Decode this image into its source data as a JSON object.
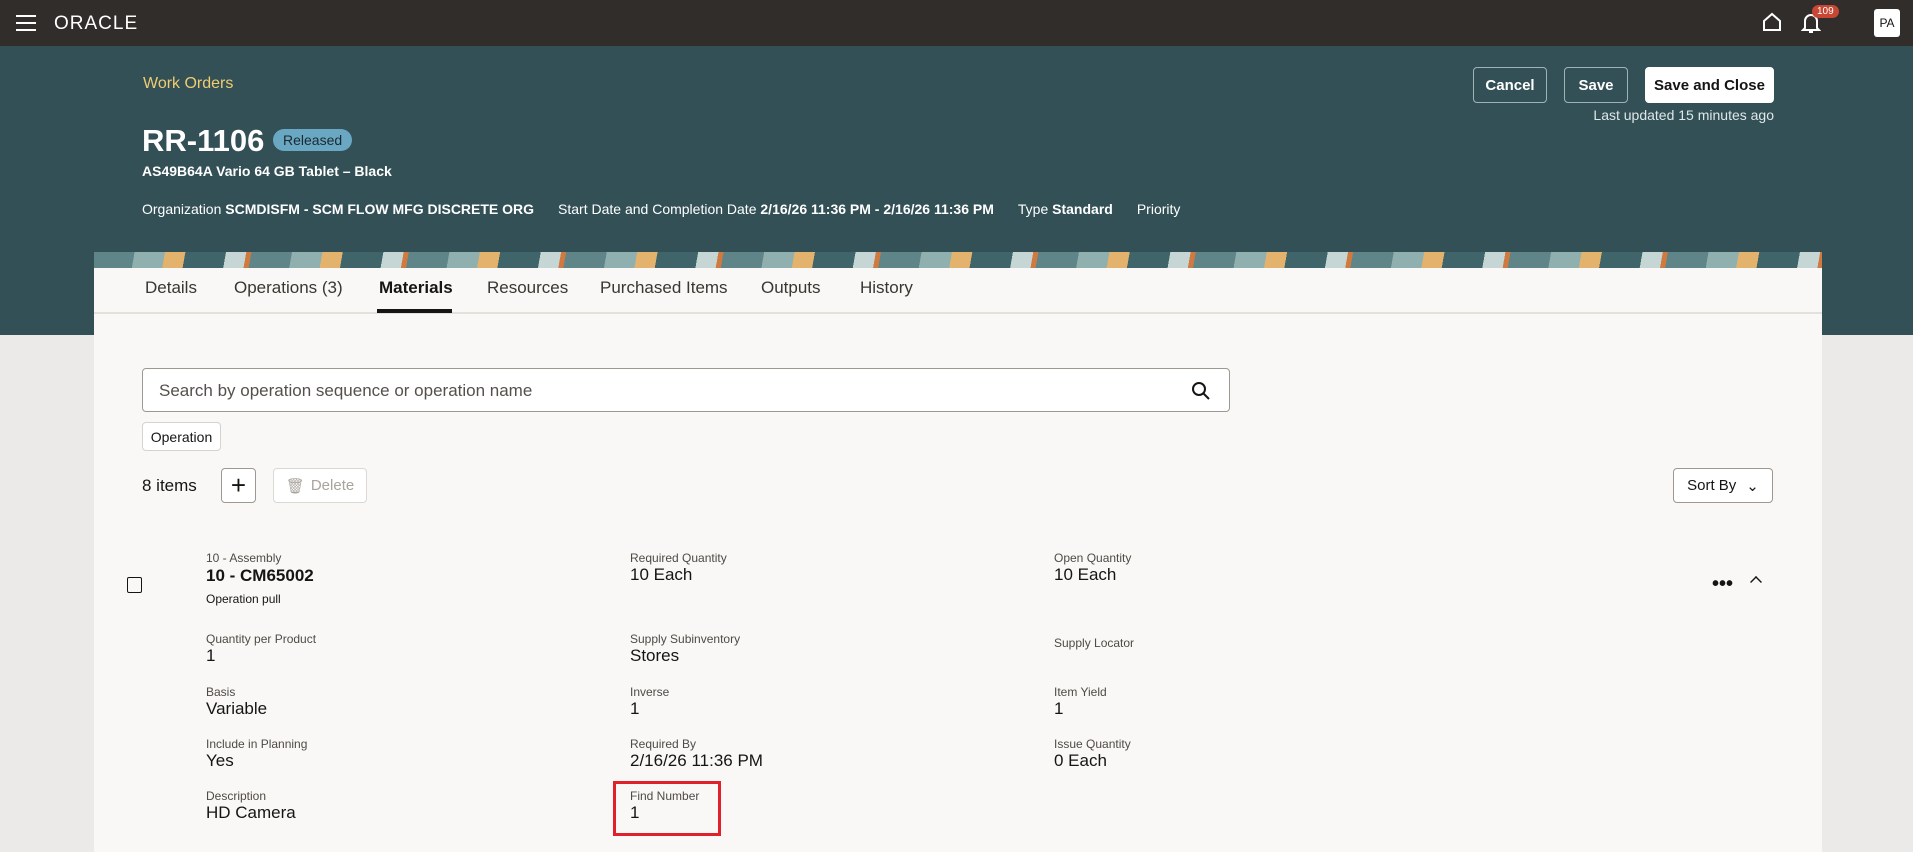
{
  "topbar": {
    "brand": "ORACLE",
    "notification_count": "109",
    "avatar": "PA"
  },
  "header": {
    "breadcrumb": "Work Orders",
    "title": "RR-1106",
    "status": "Released",
    "subtitle": "AS49B64A Vario 64 GB Tablet – Black",
    "buttons": {
      "cancel": "Cancel",
      "save": "Save",
      "save_close": "Save and Close"
    },
    "last_updated": "Last updated 15 minutes ago",
    "meta": [
      {
        "label": "Organization",
        "value": "SCMDISFM - SCM FLOW MFG DISCRETE ORG"
      },
      {
        "label": "Start Date and Completion Date",
        "value": "2/16/26 11:36 PM - 2/16/26 11:36 PM"
      },
      {
        "label": "Type",
        "value": "Standard"
      },
      {
        "label": "Priority",
        "value": ""
      }
    ]
  },
  "tabs": [
    "Details",
    "Operations (3)",
    "Materials",
    "Resources",
    "Purchased Items",
    "Outputs",
    "History"
  ],
  "active_tab": "Materials",
  "search": {
    "placeholder": "Search by operation sequence or operation name"
  },
  "filter_chip": "Operation",
  "toolbar": {
    "count": "8 items",
    "delete": "Delete",
    "sort": "Sort By"
  },
  "item": {
    "operation": "10 - Assembly",
    "title": "10 - CM65002",
    "supply_type": "Operation pull",
    "fields": [
      {
        "label": "Required Quantity",
        "value": "10 Each"
      },
      {
        "label": "Open Quantity",
        "value": "10 Each"
      },
      {
        "label": "Quantity per Product",
        "value": "1"
      },
      {
        "label": "Supply Subinventory",
        "value": "Stores"
      },
      {
        "label": "Supply Locator",
        "value": ""
      },
      {
        "label": "Basis",
        "value": "Variable"
      },
      {
        "label": "Inverse",
        "value": "1"
      },
      {
        "label": "Item Yield",
        "value": "1"
      },
      {
        "label": "Include in Planning",
        "value": "Yes"
      },
      {
        "label": "Required By",
        "value": "2/16/26 11:36 PM"
      },
      {
        "label": "Issue Quantity",
        "value": "0 Each"
      },
      {
        "label": "Description",
        "value": "HD Camera"
      },
      {
        "label": "Find Number",
        "value": "1"
      }
    ]
  }
}
